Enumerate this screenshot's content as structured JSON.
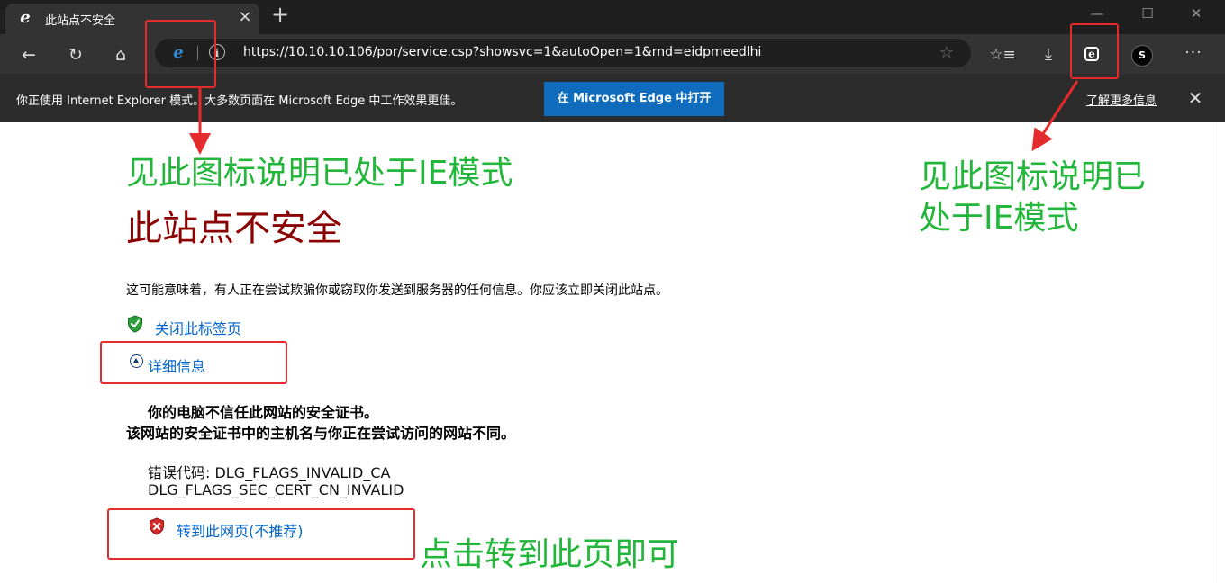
{
  "browser": {
    "tab_title": "此站点不安全",
    "new_tab_label": "+",
    "url": "https://10.10.10.106/por/service.csp?showsvc=1&autoOpen=1&rnd=eidpmeedlhi",
    "avatar_text": "S"
  },
  "infobar": {
    "message": "你正使用 Internet Explorer 模式。大多数页面在 Microsoft Edge 中工作效果更佳。",
    "open_in_edge_label": "在 Microsoft Edge 中打开",
    "learn_more_label": "了解更多信息"
  },
  "page": {
    "heading": "此站点不安全",
    "warning": "这可能意味着，有人正在尝试欺骗你或窃取你发送到服务器的任何信息。你应该立即关闭此站点。",
    "close_tab_label": "关闭此标签页",
    "details_label": "详细信息",
    "cert_line1": "你的电脑不信任此网站的安全证书。",
    "cert_line2": "该网站的安全证书中的主机名与你正在尝试访问的网站不同。",
    "error_line1": "错误代码: DLG_FLAGS_INVALID_CA",
    "error_line2": "DLG_FLAGS_SEC_CERT_CN_INVALID",
    "continue_label": "转到此网页(不推荐)"
  },
  "annotations": {
    "address_bar_note": "见此图标说明已处于IE模式",
    "toolbar_note_line1": "见此图标说明已",
    "toolbar_note_line2": "处于IE模式",
    "continue_note": "点击转到此页即可"
  },
  "colors": {
    "annotation_green": "#22b73b",
    "highlight_red": "#e52b2b",
    "heading_red": "#8b0000",
    "link_blue": "#0066cc",
    "edge_button_blue": "#0f6cbd"
  },
  "icons": [
    "ie-logo-icon",
    "close-icon",
    "back-arrow-icon",
    "refresh-icon",
    "home-icon",
    "info-icon",
    "favorite-star-icon",
    "favorites-list-icon",
    "download-icon",
    "ie-mode-icon",
    "more-icon",
    "shield-check-icon",
    "shield-x-icon",
    "chevron-up-circle-icon"
  ]
}
